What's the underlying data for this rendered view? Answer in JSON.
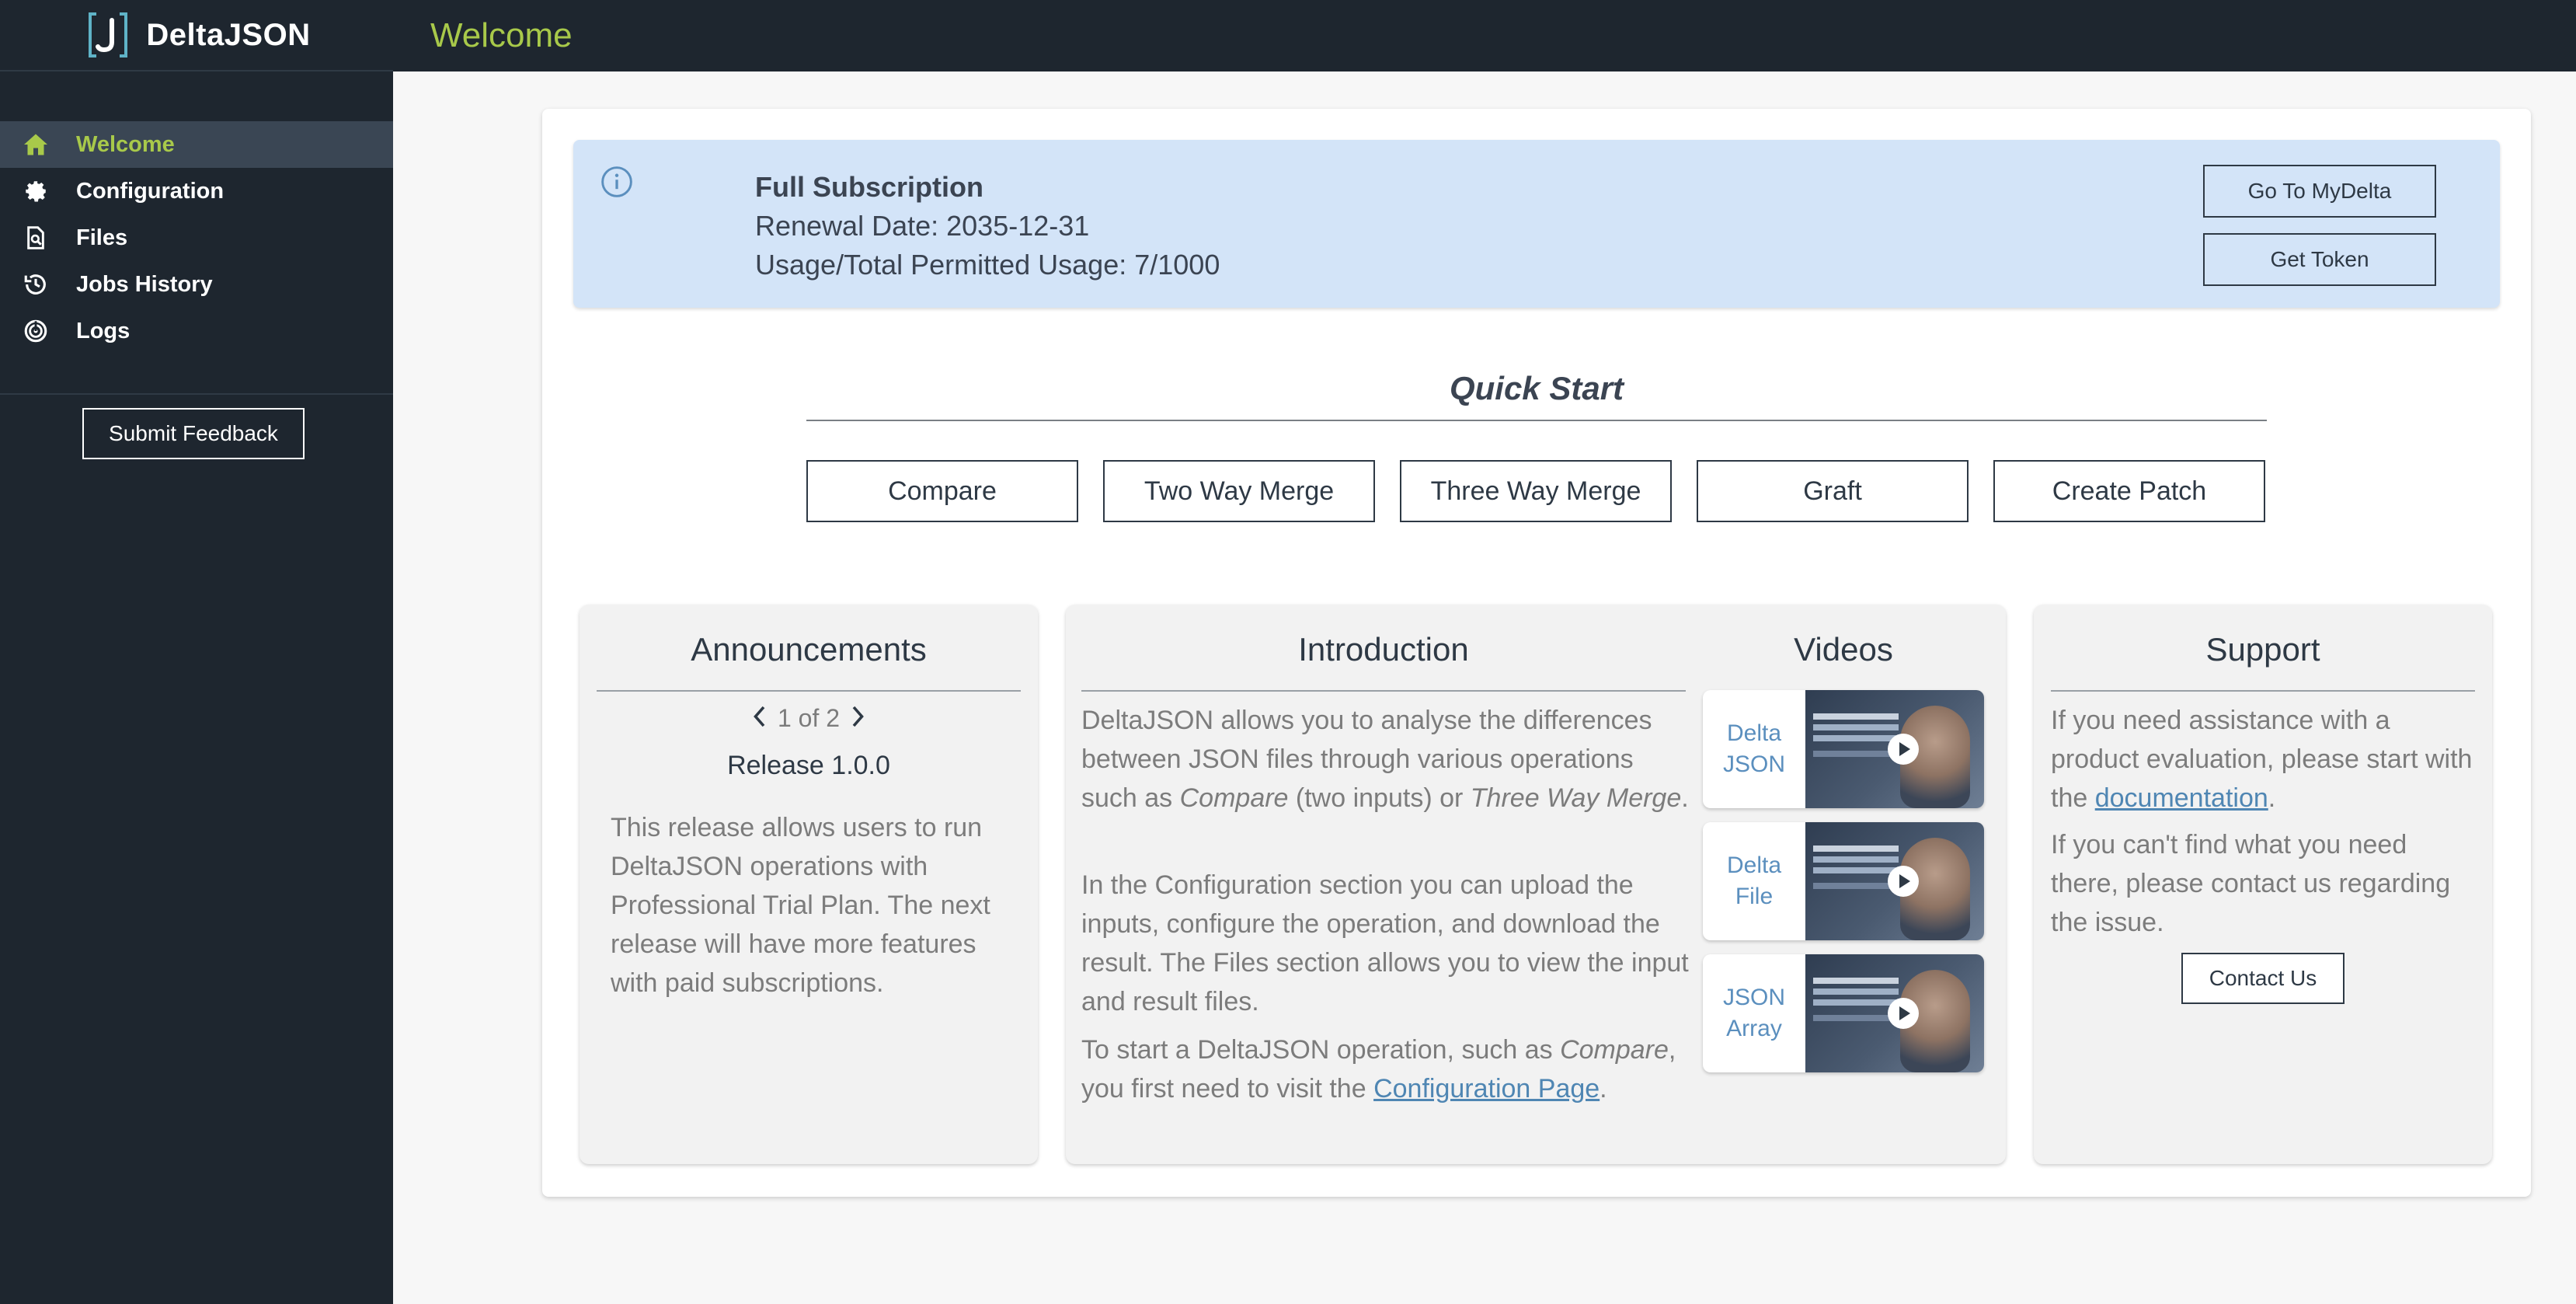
{
  "app": {
    "brand_name": "DeltaJSON",
    "brand_icon": "json-bracket-logo",
    "accent": "#a8c94a",
    "sidebar_bg": "#1e262f"
  },
  "sidebar": {
    "items": [
      {
        "label": "Welcome",
        "icon": "home-icon",
        "active": true
      },
      {
        "label": "Configuration",
        "icon": "gear-icon",
        "active": false
      },
      {
        "label": "Files",
        "icon": "file-search-icon",
        "active": false
      },
      {
        "label": "Jobs History",
        "icon": "history-icon",
        "active": false
      },
      {
        "label": "Logs",
        "icon": "logs-icon",
        "active": false
      }
    ],
    "feedback_label": "Submit Feedback"
  },
  "header": {
    "title": "Welcome"
  },
  "subscription": {
    "title": "Full Subscription",
    "renewal": "Renewal Date: 2035-12-31",
    "usage": "Usage/Total Permitted Usage: 7/1000",
    "mydelta_label": "Go To MyDelta",
    "token_label": "Get Token",
    "bg": "#d3e4f8"
  },
  "quick_start": {
    "title": "Quick Start",
    "buttons": [
      "Compare",
      "Two Way Merge",
      "Three Way Merge",
      "Graft",
      "Create Patch"
    ]
  },
  "announcements": {
    "title": "Announcements",
    "pager": "1 of 2",
    "release": "Release 1.0.0",
    "body": "This release allows users to run DeltaJSON operations with Professional Trial Plan. The next release will have more features with paid subscriptions."
  },
  "introduction": {
    "title": "Introduction",
    "p1_a": "DeltaJSON allows you to analyse the differences between JSON files through various operations such as ",
    "p1_em1": "Compare",
    "p1_b": " (two inputs) or ",
    "p1_em2": "Three Way Merge",
    "p1_c": ".",
    "p2": "In the Configuration section you can upload the inputs, configure the operation, and download the result. The Files section allows you to view the input and result files.",
    "p3_a": "To start a DeltaJSON operation, such as ",
    "p3_em": "Compare",
    "p3_b": ", you first need to visit the ",
    "p3_link": "Configuration Page",
    "p3_c": "."
  },
  "videos": {
    "title": "Videos",
    "items": [
      {
        "line1": "Delta",
        "line2": "JSON"
      },
      {
        "line1": "Delta",
        "line2": "File"
      },
      {
        "line1": "JSON",
        "line2": "Array"
      }
    ]
  },
  "support": {
    "title": "Support",
    "p1_a": "If you need assistance with a product evaluation, please start with the ",
    "p1_link": "documentation",
    "p1_b": ".",
    "p2": "If you can't find what you need there, please contact us regarding the issue.",
    "contact_label": "Contact Us"
  }
}
